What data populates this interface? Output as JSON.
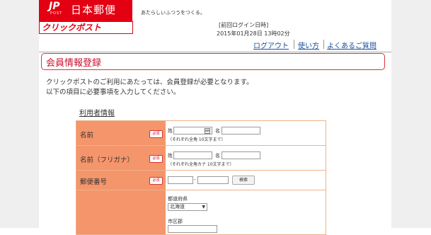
{
  "header": {
    "logo_mark": "JP",
    "logo_post": "POST",
    "logo_name": "日本郵便",
    "tagline": "あたらしいふつうをつくる。",
    "service_logo": "クリックポスト",
    "last_login_label": "[前回ログイン日時]",
    "last_login_value": "2015年01月28日 13時02分"
  },
  "links": {
    "logout": "ログアウト",
    "usage": "使い方",
    "faq": "よくあるご質問"
  },
  "page_title": "会員情報登録",
  "intro": {
    "line1": "クリックポストのご利用にあたっては、会員登録が必要となります。",
    "line2": "以下の項目に必要事項を入力してください。"
  },
  "section_title": "利用者情報",
  "required_badge": "必須",
  "form": {
    "name": {
      "label": "名前",
      "sei": "姓",
      "mei": "名",
      "hint": "（それぞれ全角 10文字まで）"
    },
    "kana": {
      "label": "名前（フリガナ）",
      "sei": "姓",
      "mei": "名",
      "hint": "（それぞれ全角カナ 10文字まで）"
    },
    "postal": {
      "label": "郵便番号",
      "dash": "-",
      "search_button": "検索"
    },
    "address": {
      "prefecture_label": "都道府県",
      "prefecture_value": "北海道",
      "city_label": "市区郡"
    }
  },
  "colors": {
    "brand_red": "#e30012",
    "label_bg": "#f4956b",
    "link": "#1a4fa0"
  }
}
